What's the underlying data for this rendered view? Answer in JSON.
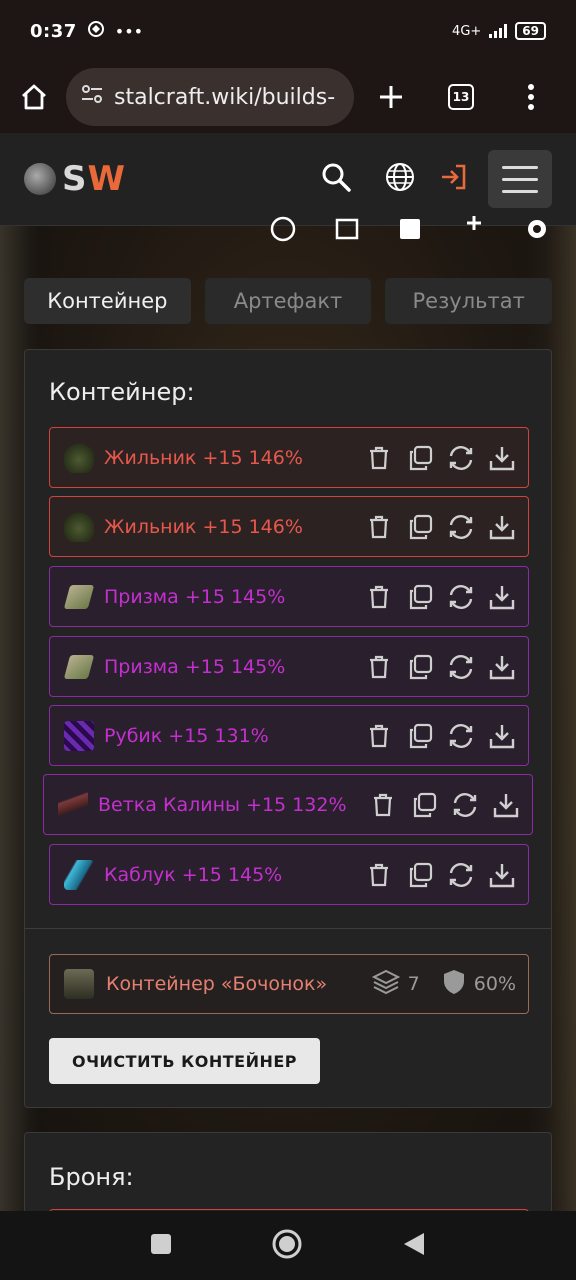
{
  "status": {
    "time": "0:37",
    "network": "4G+",
    "battery": "69"
  },
  "browser": {
    "url": "stalcraft.wiki/builds-",
    "tab_count": "13"
  },
  "site": {
    "logo_s": "S",
    "logo_w": "W"
  },
  "tabs": [
    {
      "label": "Контейнер",
      "active": true
    },
    {
      "label": "Артефакт",
      "active": false
    },
    {
      "label": "Результат",
      "active": false
    }
  ],
  "container_panel": {
    "title": "Контейнер:",
    "items": [
      {
        "label": "Жильник +15 146%",
        "rarity": "red"
      },
      {
        "label": "Жильник +15 146%",
        "rarity": "red"
      },
      {
        "label": "Призма +15 145%",
        "rarity": "purple"
      },
      {
        "label": "Призма +15 145%",
        "rarity": "purple"
      },
      {
        "label": "Рубик +15 131%",
        "rarity": "purple"
      },
      {
        "label": "Ветка Калины +15 132%",
        "rarity": "purple"
      },
      {
        "label": "Каблук +15 145%",
        "rarity": "purple"
      }
    ],
    "container": {
      "name": "Контейнер «Бочонок»",
      "slots": "7",
      "protection": "60%"
    },
    "clear_button": "ОЧИСТИТЬ КОНТЕЙНЕР"
  },
  "armor_panel": {
    "title": "Броня:"
  },
  "colors": {
    "accent": "#e86a3a",
    "red_rarity": "#e6584b",
    "purple_rarity": "#c430cf"
  }
}
